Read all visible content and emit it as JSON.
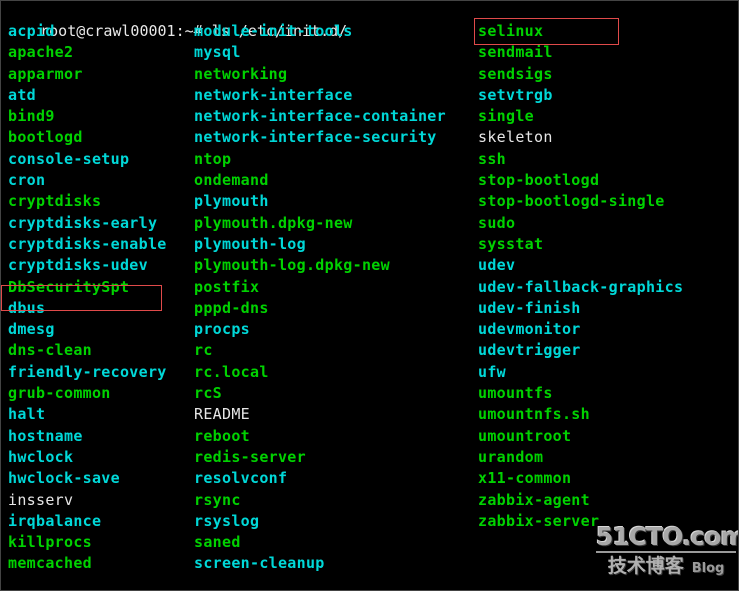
{
  "terminal": {
    "background_color": "#000000",
    "prompt": {
      "user_host": "root@crawl00001:~#",
      "command": " ls /etc/init.d/",
      "full_line": "root@crawl00001:~# ls /etc/init.d/",
      "color": "#e8e8e8"
    },
    "colors": {
      "executable": "#00d200",
      "symlink": "#00d8d8",
      "regular_file": "#e6e6e6",
      "highlight_box": "#e04a4a"
    },
    "columns": [
      {
        "name": "column-1",
        "entries": [
          {
            "label": "acpid",
            "type": "link"
          },
          {
            "label": "apache2",
            "type": "exec"
          },
          {
            "label": "apparmor",
            "type": "exec"
          },
          {
            "label": "atd",
            "type": "link"
          },
          {
            "label": "bind9",
            "type": "exec"
          },
          {
            "label": "bootlogd",
            "type": "exec"
          },
          {
            "label": "console-setup",
            "type": "link"
          },
          {
            "label": "cron",
            "type": "link"
          },
          {
            "label": "cryptdisks",
            "type": "exec"
          },
          {
            "label": "cryptdisks-early",
            "type": "link"
          },
          {
            "label": "cryptdisks-enable",
            "type": "link"
          },
          {
            "label": "cryptdisks-udev",
            "type": "link"
          },
          {
            "label": "DbSecuritySpt",
            "type": "exec",
            "highlighted": true
          },
          {
            "label": "dbus",
            "type": "link"
          },
          {
            "label": "dmesg",
            "type": "link"
          },
          {
            "label": "dns-clean",
            "type": "exec"
          },
          {
            "label": "friendly-recovery",
            "type": "link"
          },
          {
            "label": "grub-common",
            "type": "exec"
          },
          {
            "label": "halt",
            "type": "link"
          },
          {
            "label": "hostname",
            "type": "link"
          },
          {
            "label": "hwclock",
            "type": "link"
          },
          {
            "label": "hwclock-save",
            "type": "link"
          },
          {
            "label": "insserv",
            "type": "file"
          },
          {
            "label": "irqbalance",
            "type": "link"
          },
          {
            "label": "killprocs",
            "type": "exec"
          },
          {
            "label": "memcached",
            "type": "exec"
          }
        ]
      },
      {
        "name": "column-2",
        "entries": [
          {
            "label": "module-init-tools",
            "type": "link"
          },
          {
            "label": "mysql",
            "type": "link"
          },
          {
            "label": "networking",
            "type": "exec"
          },
          {
            "label": "network-interface",
            "type": "link"
          },
          {
            "label": "network-interface-container",
            "type": "link"
          },
          {
            "label": "network-interface-security",
            "type": "link"
          },
          {
            "label": "ntop",
            "type": "exec"
          },
          {
            "label": "ondemand",
            "type": "exec"
          },
          {
            "label": "plymouth",
            "type": "link"
          },
          {
            "label": "plymouth.dpkg-new",
            "type": "exec"
          },
          {
            "label": "plymouth-log",
            "type": "link"
          },
          {
            "label": "plymouth-log.dpkg-new",
            "type": "exec"
          },
          {
            "label": "postfix",
            "type": "exec"
          },
          {
            "label": "pppd-dns",
            "type": "exec"
          },
          {
            "label": "procps",
            "type": "link"
          },
          {
            "label": "rc",
            "type": "exec"
          },
          {
            "label": "rc.local",
            "type": "exec"
          },
          {
            "label": "rcS",
            "type": "exec"
          },
          {
            "label": "README",
            "type": "file"
          },
          {
            "label": "reboot",
            "type": "exec"
          },
          {
            "label": "redis-server",
            "type": "exec"
          },
          {
            "label": "resolvconf",
            "type": "link"
          },
          {
            "label": "rsync",
            "type": "exec"
          },
          {
            "label": "rsyslog",
            "type": "link"
          },
          {
            "label": "saned",
            "type": "exec"
          },
          {
            "label": "screen-cleanup",
            "type": "link"
          }
        ]
      },
      {
        "name": "column-3",
        "entries": [
          {
            "label": "selinux",
            "type": "exec",
            "highlighted": true
          },
          {
            "label": "sendmail",
            "type": "exec"
          },
          {
            "label": "sendsigs",
            "type": "exec"
          },
          {
            "label": "setvtrgb",
            "type": "link"
          },
          {
            "label": "single",
            "type": "exec"
          },
          {
            "label": "skeleton",
            "type": "file"
          },
          {
            "label": "ssh",
            "type": "exec"
          },
          {
            "label": "stop-bootlogd",
            "type": "exec"
          },
          {
            "label": "stop-bootlogd-single",
            "type": "exec"
          },
          {
            "label": "sudo",
            "type": "exec"
          },
          {
            "label": "sysstat",
            "type": "exec"
          },
          {
            "label": "udev",
            "type": "link"
          },
          {
            "label": "udev-fallback-graphics",
            "type": "link"
          },
          {
            "label": "udev-finish",
            "type": "link"
          },
          {
            "label": "udevmonitor",
            "type": "link"
          },
          {
            "label": "udevtrigger",
            "type": "link"
          },
          {
            "label": "ufw",
            "type": "link"
          },
          {
            "label": "umountfs",
            "type": "exec"
          },
          {
            "label": "umountnfs.sh",
            "type": "exec"
          },
          {
            "label": "umountroot",
            "type": "exec"
          },
          {
            "label": "urandom",
            "type": "exec"
          },
          {
            "label": "x11-common",
            "type": "exec"
          },
          {
            "label": "zabbix-agent",
            "type": "exec"
          },
          {
            "label": "zabbix-server",
            "type": "exec"
          }
        ]
      }
    ]
  },
  "watermark": {
    "main": "51CTO.com",
    "subtitle_cn": "技术博客",
    "subtitle_en": "Blog"
  }
}
